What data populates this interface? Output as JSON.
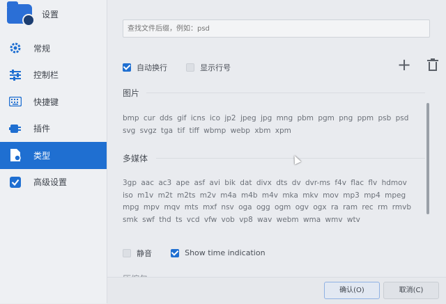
{
  "sidebar": {
    "title": "设置",
    "items": [
      {
        "label": "常规",
        "icon": "gear-icon"
      },
      {
        "label": "控制栏",
        "icon": "sliders-icon"
      },
      {
        "label": "快捷键",
        "icon": "keyboard-icon"
      },
      {
        "label": "插件",
        "icon": "plugin-icon"
      },
      {
        "label": "类型",
        "icon": "file-type-icon",
        "active": true
      },
      {
        "label": "高级设置",
        "icon": "checkbox-icon"
      }
    ]
  },
  "main": {
    "search": {
      "placeholder": "查找文件后缀，例如：psd"
    },
    "options": {
      "auto_wrap": {
        "label": "自动换行",
        "checked": true
      },
      "show_line_numbers": {
        "label": "显示行号",
        "checked": false
      }
    },
    "sections": [
      {
        "title": "图片",
        "extensions": "bmp cur dds gif icns ico jp2 jpeg jpg mng pbm pgm png ppm psb psd svg svgz tga tif tiff wbmp webp xbm xpm"
      },
      {
        "title": "多媒体",
        "extensions": "3gp aac ac3 ape asf avi bik dat divx dts dv dvr-ms f4v flac flv hdmov iso m1v m2t m2ts m2v m4a m4b m4v mka mkv mov mp3 mp4 mpeg mpg mpv mqv mts mxf nsv oga ogg ogm ogv ogx ra ram rec rm rmvb smk swf thd ts vcd vfw vob vp8 wav webm wma wmv wtv"
      }
    ],
    "media_options": {
      "mute": {
        "label": "静音",
        "checked": false
      },
      "show_time": {
        "label": "Show time indication",
        "checked": true
      }
    },
    "next_section_title": "压缩包"
  },
  "footer": {
    "ok_label": "确认(O)",
    "cancel_label": "取消(C)"
  },
  "colors": {
    "accent": "#1f6fd1",
    "sidebar_bg": "#eef0f3",
    "main_bg": "#e9ebef"
  }
}
